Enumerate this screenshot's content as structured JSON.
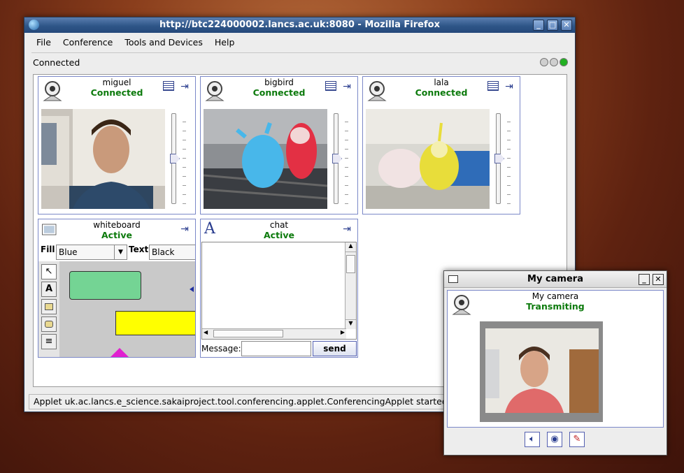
{
  "window": {
    "title": "http://btc224000002.lancs.ac.uk:8080 - Mozilla Firefox",
    "controls": [
      "_",
      "□",
      "✕"
    ]
  },
  "menu": [
    "File",
    "Conference",
    "Tools and Devices",
    "Help"
  ],
  "connection": {
    "label": "Connected",
    "indicator_colors": [
      "#cfcfcf",
      "#cfcfcf",
      "#22b022"
    ]
  },
  "participants": [
    {
      "name": "miguel",
      "status": "Connected"
    },
    {
      "name": "bigbird",
      "status": "Connected"
    },
    {
      "name": "lala",
      "status": "Connected"
    }
  ],
  "whiteboard": {
    "name": "whiteboard",
    "status": "Active",
    "fill_label": "Fill",
    "fill_value": "Blue",
    "text_label": "Text",
    "text_value": "Black"
  },
  "chat": {
    "name": "chat",
    "status": "Active",
    "message_label": "Message:",
    "message_value": "",
    "send_label": "send"
  },
  "status_bar": "Applet uk.ac.lancs.e_science.sakaiproject.tool.conferencing.applet.ConferencingApplet started",
  "my_camera": {
    "window_title": "My camera",
    "name": "My camera",
    "status": "Transmiting"
  },
  "colors": {
    "status_green": "#0c7a0c",
    "accent": "#7b88c8"
  }
}
